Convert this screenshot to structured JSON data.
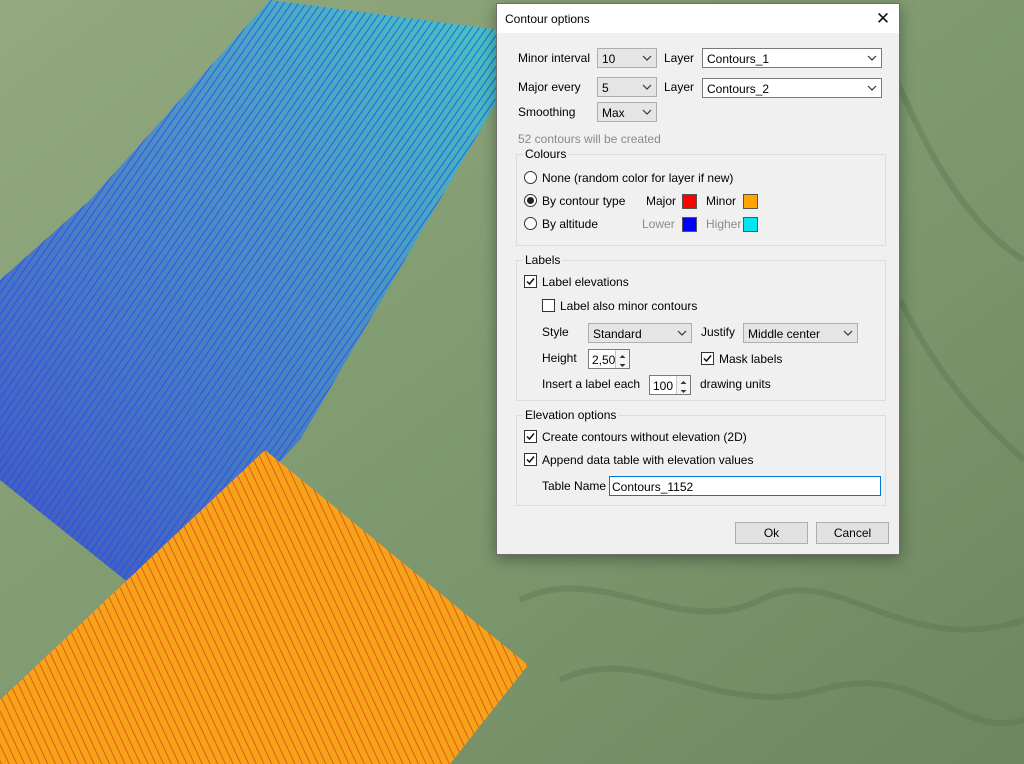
{
  "dialog": {
    "title": "Contour options",
    "minor_interval": {
      "label": "Minor interval",
      "value": "10"
    },
    "major_every": {
      "label": "Major every",
      "value": "5"
    },
    "smoothing": {
      "label": "Smoothing",
      "value": "Max"
    },
    "layer_minor": {
      "label": "Layer",
      "value": "Contours_1"
    },
    "layer_major": {
      "label": "Layer",
      "value": "Contours_2"
    },
    "info": "52 contours will be created",
    "colours": {
      "title": "Colours",
      "none_label": "None (random color for layer if new)",
      "by_type_label": "By contour type",
      "by_altitude_label": "By altitude",
      "selected": "by_type",
      "major_label": "Major",
      "minor_label": "Minor",
      "lower_label": "Lower",
      "higher_label": "Higher",
      "major_color": "#ff0000",
      "minor_color": "#ffa500",
      "lower_color": "#0000ff",
      "higher_color": "#00e5ee"
    },
    "labels": {
      "title": "Labels",
      "label_elevations": "Label elevations",
      "label_elevations_checked": true,
      "label_minor": "Label also minor contours",
      "label_minor_checked": false,
      "style_label": "Style",
      "style_value": "Standard",
      "justify_label": "Justify",
      "justify_value": "Middle center",
      "height_label": "Height",
      "height_value": "2,50",
      "mask_label": "Mask labels",
      "mask_checked": true,
      "insert_label": "Insert a label each",
      "insert_value": "100",
      "units_label": "drawing units"
    },
    "elevation": {
      "title": "Elevation options",
      "create_2d": "Create contours without elevation (2D)",
      "create_2d_checked": true,
      "append_table": "Append data table with elevation values",
      "append_table_checked": true,
      "table_name_label": "Table Name",
      "table_name_value": "Contours_1152"
    },
    "ok_label": "Ok",
    "cancel_label": "Cancel"
  }
}
